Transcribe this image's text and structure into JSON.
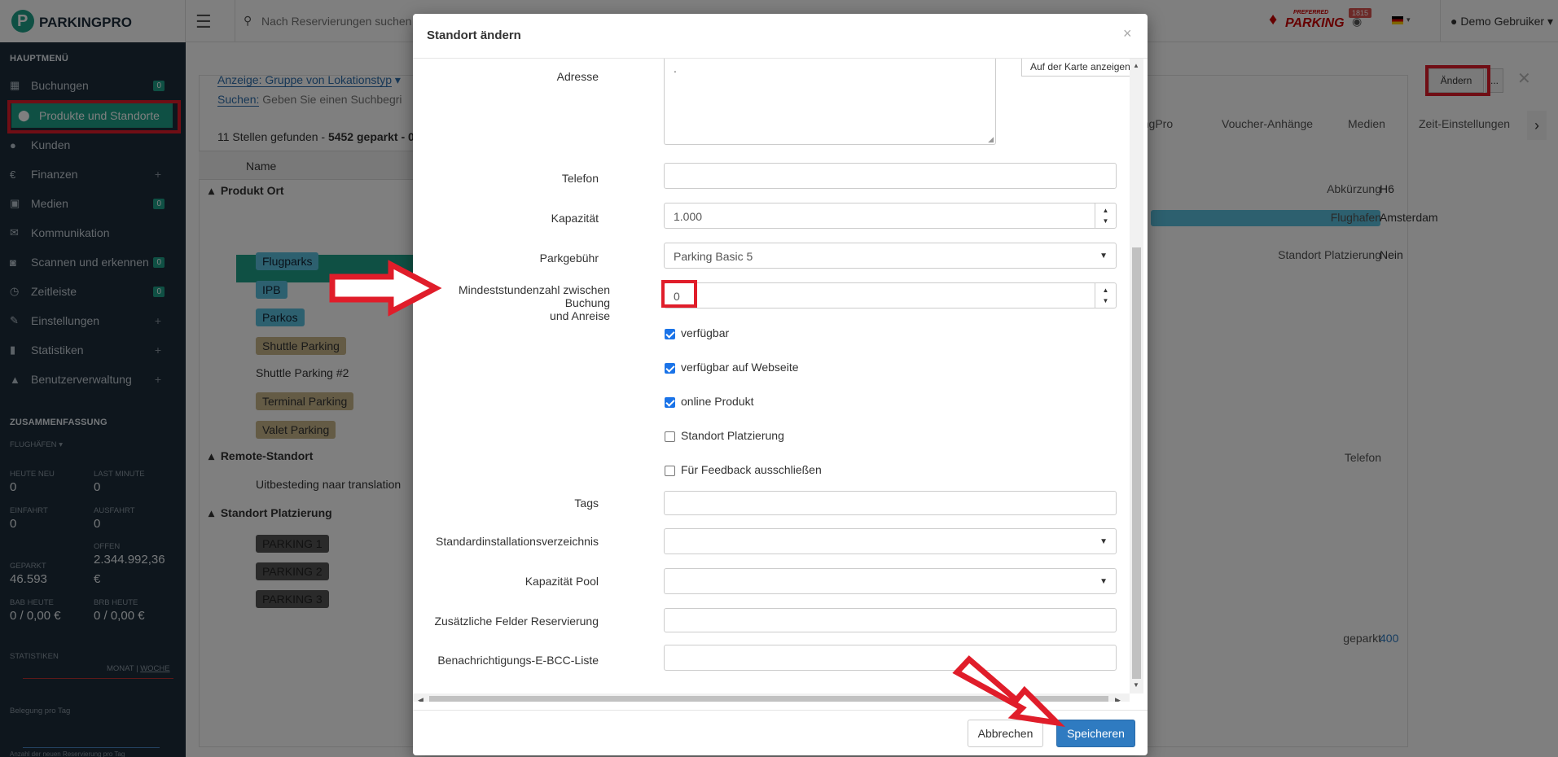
{
  "app": {
    "logo": "PARKINGPRO",
    "search_placeholder": "Nach Reservierungen suchen",
    "notif_count": "1815",
    "preferred_logo": "PARKING",
    "preferred_top": "PREFERRED",
    "user": "Demo Gebruiker"
  },
  "sidebar": {
    "main_title": "HAUPTMENÜ",
    "items": [
      {
        "label": "Buchungen",
        "icon": "calendar-icon",
        "badge": "0"
      },
      {
        "label": "Produkte und Standorte",
        "icon": "map-marker-icon",
        "badge": ""
      },
      {
        "label": "Kunden",
        "icon": "user-icon",
        "badge": ""
      },
      {
        "label": "Finanzen",
        "icon": "euro-icon",
        "badge": "+"
      },
      {
        "label": "Medien",
        "icon": "image-icon",
        "badge": "0"
      },
      {
        "label": "Kommunikation",
        "icon": "envelope-icon",
        "badge": ""
      },
      {
        "label": "Scannen und erkennen",
        "icon": "camera-icon",
        "badge": "0"
      },
      {
        "label": "Zeitleiste",
        "icon": "clock-icon",
        "badge": "0"
      },
      {
        "label": "Einstellungen",
        "icon": "wrench-icon",
        "badge": "+"
      },
      {
        "label": "Statistiken",
        "icon": "bar-chart-icon",
        "badge": "+"
      },
      {
        "label": "Benutzerverwaltung",
        "icon": "lock-icon",
        "badge": "+"
      }
    ],
    "summary_title": "ZUSAMMENFASSUNG",
    "airports": "FLUGHÄFEN",
    "stats": {
      "heute_neu_label": "HEUTE NEU",
      "heute_neu": "0",
      "last_minute_label": "LAST MINUTE",
      "last_minute": "0",
      "einfahrt_label": "EINFAHRT",
      "einfahrt": "0",
      "ausfahrt_label": "AUSFAHRT",
      "ausfahrt": "0",
      "offen_label": "OFFEN",
      "offen": "2.344.992,36",
      "offen_currency": "€",
      "geparkt_label": "GEPARKT",
      "geparkt": "46.593",
      "bab_label": "BAB HEUTE",
      "bab": "0 / 0,00 €",
      "brb_label": "BRB HEUTE",
      "brb": "0 / 0,00 €"
    },
    "statistiken_title": "STATISTIKEN",
    "monat": "MONAT",
    "woche": "WOCHE",
    "belegung": "Belegung pro Tag",
    "anzahl": "Anzahl der neuen Reservierung pro Tag"
  },
  "list": {
    "anzeige": "Anzeige: Gruppe von Lokationstyp",
    "suchen_label": "Suchen:",
    "suchen_placeholder": "Geben Sie einen Suchbegri",
    "found_pre": "11 Stellen gefunden - ",
    "found_bold": "5452",
    "found_post": " geparkt - 0",
    "col_name": "Name",
    "groups": [
      {
        "name": "Produkt Ort"
      },
      {
        "name": "Remote-Standort"
      },
      {
        "name": "Standort Platzierung"
      }
    ],
    "rows": [
      "Flugparks",
      "IPB",
      "Parkos",
      "Shuttle Parking",
      "Shuttle Parking #2",
      "Terminal Parking",
      "Valet Parking",
      "Uitbesteding naar translation",
      "PARKING 1",
      "PARKING 2",
      "PARKING 3"
    ]
  },
  "detail": {
    "aendern": "Ändern",
    "more": "...",
    "tabs": [
      "rkingPro",
      "Voucher-Anhänge",
      "Medien",
      "Zeit-Einstellungen"
    ],
    "abk_label": "Abkürzung",
    "abk": "H6",
    "flug_label": "Flughafen",
    "flug": "Amsterdam",
    "plat_label": "Standort Platzierung",
    "plat": "Nein",
    "tel_label": "Telefon",
    "geparkt_label": "geparkt",
    "geparkt": "400"
  },
  "modal": {
    "title": "Standort ändern",
    "close": "×",
    "map_button": "Auf der Karte anzeigen",
    "fields": {
      "adresse": "Adresse",
      "adresse_value": ".",
      "telefon": "Telefon",
      "kapazitaet": "Kapazität",
      "kapazitaet_value": "1.000",
      "parkgebuehr": "Parkgebühr",
      "parkgebuehr_value": "Parking Basic 5",
      "mindest_1": "Mindeststundenzahl zwischen Buchung",
      "mindest_2": "und Anreise",
      "mindest_value": "0",
      "tags": "Tags",
      "standardinst": "Standardinstallationsverzeichnis",
      "pool": "Kapazität Pool",
      "zusaetzlich": "Zusätzliche Felder Reservierung",
      "bcc": "Benachrichtigungs-E-BCC-Liste"
    },
    "checks": [
      {
        "label": "verfügbar",
        "checked": true
      },
      {
        "label": "verfügbar auf Webseite",
        "checked": true
      },
      {
        "label": "online Produkt",
        "checked": true
      },
      {
        "label": "Standort Platzierung",
        "checked": false
      },
      {
        "label": "Für Feedback ausschließen",
        "checked": false
      }
    ],
    "cancel": "Abbrechen",
    "save": "Speicheren"
  },
  "colors": {
    "sidebar": "#1d2d3b",
    "active": "#1fa088",
    "highlight": "#e01d2a",
    "primary": "#2f7bc1"
  }
}
